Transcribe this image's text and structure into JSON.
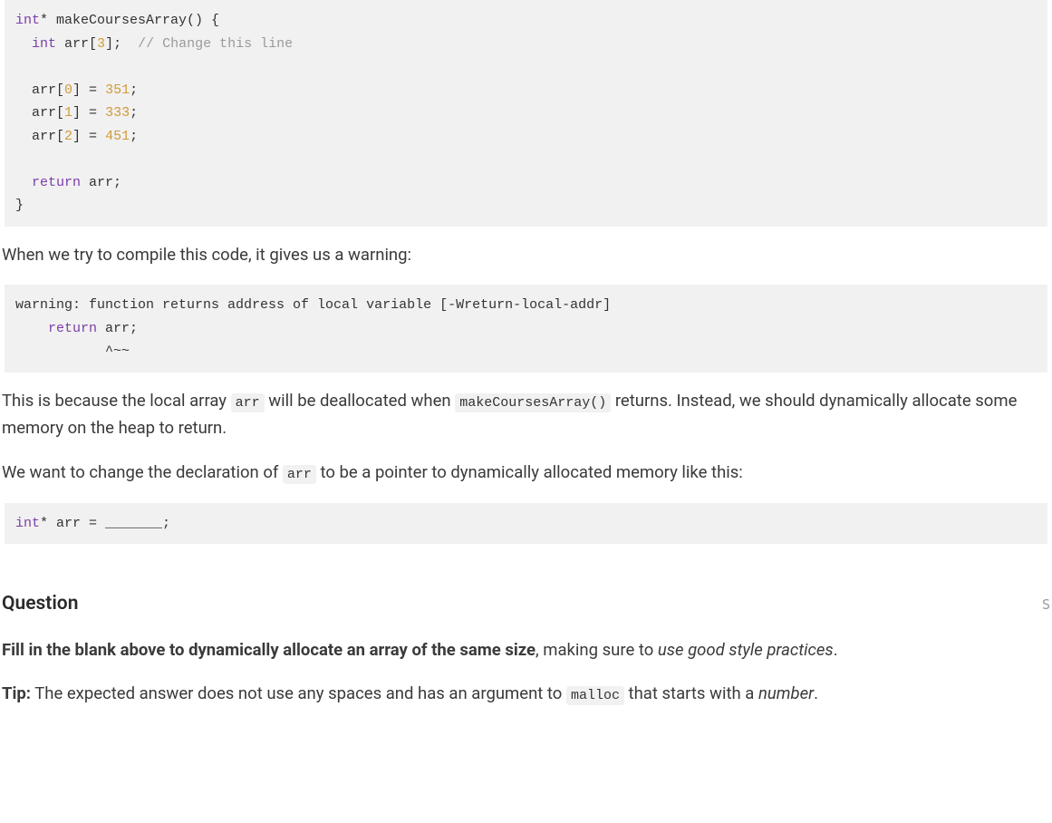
{
  "code1": {
    "l1": {
      "type": "int",
      "star": "*",
      "fn": " makeCoursesArray() {"
    },
    "l2": {
      "indent": "  ",
      "type": "int",
      "decl": " arr[",
      "idx": "3",
      "close": "];  ",
      "comment": "// Change this line"
    },
    "l3": "",
    "l4": {
      "indent": "  ",
      "lhs": "arr[",
      "idx": "0",
      "mid": "] = ",
      "val": "351",
      "end": ";"
    },
    "l5": {
      "indent": "  ",
      "lhs": "arr[",
      "idx": "1",
      "mid": "] = ",
      "val": "333",
      "end": ";"
    },
    "l6": {
      "indent": "  ",
      "lhs": "arr[",
      "idx": "2",
      "mid": "] = ",
      "val": "451",
      "end": ";"
    },
    "l7": "",
    "l8": {
      "indent": "  ",
      "ret": "return",
      "rest": " arr;"
    },
    "l9": "}"
  },
  "para1": "When we try to compile this code, it gives us a warning:",
  "code2": {
    "l1": "warning: function returns address of local variable [-Wreturn-local-addr]",
    "l2": {
      "indent": "    ",
      "ret": "return",
      "rest": " arr;"
    },
    "l3": "           ^~~"
  },
  "para2": {
    "a": "This is because the local array ",
    "arr": "arr",
    "b": " will be deallocated when ",
    "fn": "makeCoursesArray()",
    "c": " returns. Instead, we should dynamically allocate some memory on the heap to return."
  },
  "para3": {
    "a": "We want to change the declaration of ",
    "arr": "arr",
    "b": " to be a pointer to dynamically allocated memory like this:"
  },
  "code3": {
    "type": "int",
    "rest": "* arr = _______;"
  },
  "qheader": "Question",
  "qtag": "S",
  "prompt1": {
    "bold": "Fill in the blank above to dynamically allocate an array of the same size",
    "plain": ", making sure to ",
    "ital": "use good style practices",
    "end": "."
  },
  "prompt2": {
    "tipLabel": "Tip:",
    "a": " The expected answer does not use any spaces and has an argument to ",
    "malloc": "malloc",
    "b": " that starts with a ",
    "number": "number",
    "end": "."
  }
}
